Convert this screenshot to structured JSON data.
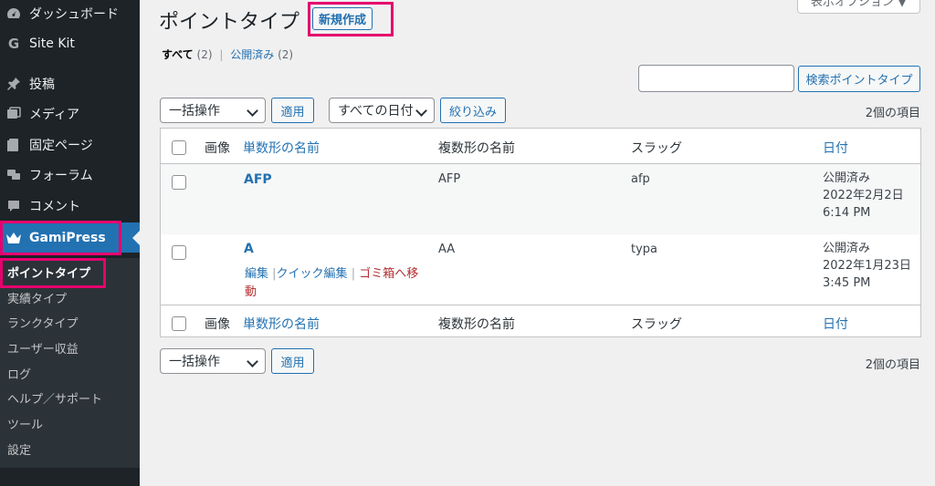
{
  "sidebar": {
    "items": [
      {
        "label": "ダッシュボード",
        "icon": "dashboard-icon"
      },
      {
        "label": "Site Kit",
        "icon": "google-g-icon"
      },
      {
        "label": "投稿",
        "icon": "pin-icon"
      },
      {
        "label": "メディア",
        "icon": "media-icon"
      },
      {
        "label": "固定ページ",
        "icon": "page-icon"
      },
      {
        "label": "フォーラム",
        "icon": "forum-icon"
      },
      {
        "label": "コメント",
        "icon": "comment-icon"
      },
      {
        "label": "GamiPress",
        "icon": "crown-icon"
      }
    ],
    "submenu": [
      "ポイントタイプ",
      "実績タイプ",
      "ランクタイプ",
      "ユーザー収益",
      "ログ",
      "ヘルプ／サポート",
      "ツール",
      "設定"
    ]
  },
  "header": {
    "title": "ポイントタイプ",
    "add_new": "新規作成",
    "screen_options": "表示オプション ▼"
  },
  "filters": {
    "all": "すべて",
    "all_count": "(2)",
    "sep": "|",
    "published": "公開済み",
    "published_count": "(2)"
  },
  "search": {
    "button": "検索ポイントタイプ",
    "value": ""
  },
  "tablenav": {
    "bulk_action": "一括操作",
    "apply": "適用",
    "all_dates": "すべての日付",
    "filter": "絞り込み",
    "items_count": "2個の項目"
  },
  "table": {
    "columns": {
      "image": "画像",
      "singular": "単数形の名前",
      "plural": "複数形の名前",
      "slug": "スラッグ",
      "date": "日付"
    },
    "rows": [
      {
        "title": "AFP",
        "plural": "AFP",
        "slug": "afp",
        "status": "公開済み",
        "date": "2022年2月2日",
        "time": "6:14 PM"
      },
      {
        "title": "A",
        "plural": "AA",
        "slug": "typa",
        "status": "公開済み",
        "date": "2022年1月23日",
        "time": "3:45 PM"
      }
    ],
    "row_actions": {
      "edit": "編集",
      "quick_edit": "クイック編集",
      "trash_line1": "ゴミ箱へ移",
      "trash_line2": "動",
      "sep": "|"
    }
  },
  "colors": {
    "highlight": "#e6006e",
    "accent": "#2271b1",
    "sidebar": "#1d2327"
  }
}
